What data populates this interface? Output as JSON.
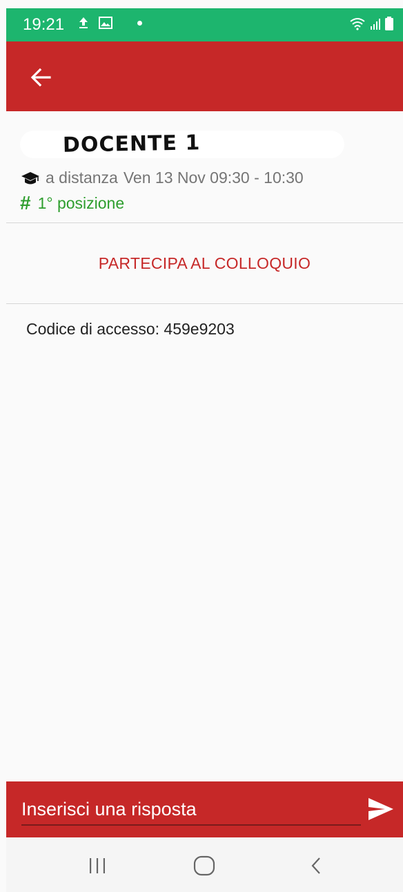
{
  "status_bar": {
    "time": "19:21"
  },
  "teacher": {
    "name": "DOCENTE 1"
  },
  "meeting": {
    "mode": "a distanza",
    "when": "Ven 13 Nov 09:30 - 10:30",
    "position": "1° posizione"
  },
  "actions": {
    "join_label": "PARTECIPA AL COLLOQUIO"
  },
  "details": {
    "access_code": "Codice di accesso: 459e9203"
  },
  "reply": {
    "placeholder": "Inserisci una risposta"
  },
  "colors": {
    "accent": "#c62828",
    "status": "#1db56e",
    "position": "#2e9e2e"
  },
  "icons": [
    "back-arrow-icon",
    "graduation-cap-icon",
    "hash-icon",
    "send-icon",
    "recent-apps-icon",
    "home-icon",
    "back-nav-icon"
  ]
}
